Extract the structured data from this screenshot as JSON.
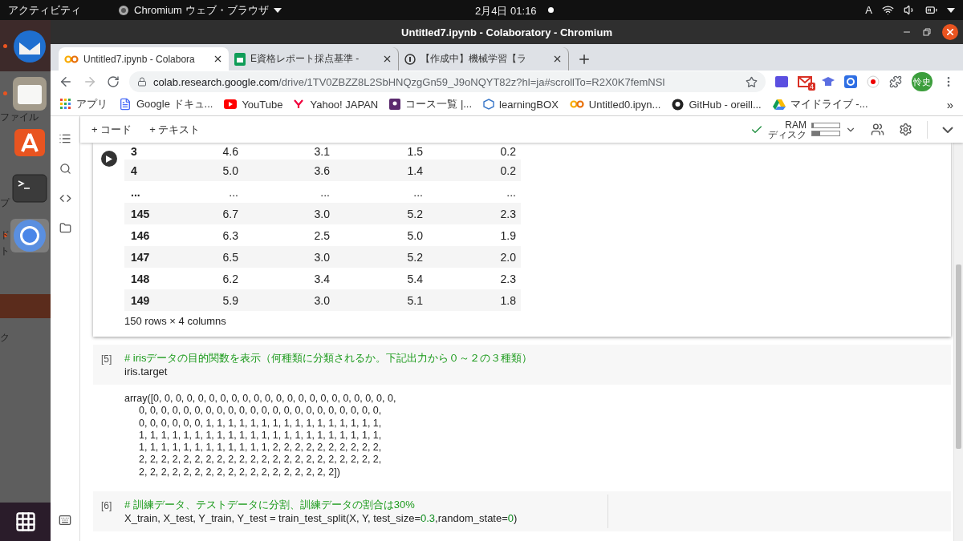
{
  "topbar": {
    "activities": "アクティビティ",
    "app_menu": "Chromium ウェブ・ブラウザ",
    "clock": "2月4日  01:16",
    "input_method": "A"
  },
  "dock": {
    "items": [
      {
        "kind": "mail",
        "running": true,
        "selected": false
      },
      {
        "kind": "files",
        "running": true,
        "selected": false
      },
      {
        "kind": "store",
        "running": false,
        "selected": false
      },
      {
        "kind": "terminal",
        "running": false,
        "selected": false
      },
      {
        "kind": "browser",
        "running": true,
        "selected": true
      }
    ],
    "label": "ファイル",
    "fragments": [
      "プ",
      "ド",
      "ト",
      "ク"
    ]
  },
  "window": {
    "title": "Untitled7.ipynb - Colaboratory - Chromium"
  },
  "tabs": [
    {
      "kind": "colab",
      "title": "Untitled7.ipynb - Colabora",
      "selected": true
    },
    {
      "kind": "sheets",
      "title": "E資格レポート採点基準 -",
      "selected": false
    },
    {
      "kind": "generic",
      "title": "【作成中】機械学習【ラ",
      "selected": false
    }
  ],
  "address": {
    "host": "colab.research.google.com",
    "path": "/drive/1TV0ZBZZ8L2SbHNQzgGn59_J9oNQYT82z?hl=ja#scrollTo=R2X0K7femNSl"
  },
  "extensions": {
    "mail_badge": "4",
    "profile": "怜史"
  },
  "bookmarks": [
    {
      "kind": "apps",
      "label": "アプリ"
    },
    {
      "kind": "docs",
      "label": "Google ドキュ..."
    },
    {
      "kind": "youtube",
      "label": "YouTube"
    },
    {
      "kind": "yahoo",
      "label": "Yahoo! JAPAN"
    },
    {
      "kind": "course",
      "label": "コース一覧 |..."
    },
    {
      "kind": "box",
      "label": "learningBOX"
    },
    {
      "kind": "colab",
      "label": "Untitled0.ipyn..."
    },
    {
      "kind": "github",
      "label": "GitHub - oreill..."
    },
    {
      "kind": "drive",
      "label": "マイドライブ -..."
    }
  ],
  "bookmarks_overflow": "»",
  "toolbar": {
    "add_code": "+ コード",
    "add_text": "+ テキスト",
    "ram": {
      "label": "RAM",
      "level": 0.05
    },
    "disk": {
      "label": "ディスク",
      "level": 0.3
    }
  },
  "table": {
    "rows": [
      {
        "index": "3",
        "values": [
          "4.6",
          "3.1",
          "1.5",
          "0.2"
        ]
      },
      {
        "index": "4",
        "values": [
          "5.0",
          "3.6",
          "1.4",
          "0.2"
        ]
      },
      {
        "index": "...",
        "values": [
          "...",
          "...",
          "...",
          "..."
        ]
      },
      {
        "index": "145",
        "values": [
          "6.7",
          "3.0",
          "5.2",
          "2.3"
        ]
      },
      {
        "index": "146",
        "values": [
          "6.3",
          "2.5",
          "5.0",
          "1.9"
        ]
      },
      {
        "index": "147",
        "values": [
          "6.5",
          "3.0",
          "5.2",
          "2.0"
        ]
      },
      {
        "index": "148",
        "values": [
          "6.2",
          "3.4",
          "5.4",
          "2.3"
        ]
      },
      {
        "index": "149",
        "values": [
          "5.9",
          "3.0",
          "5.1",
          "1.8"
        ]
      }
    ],
    "footer": "150 rows × 4 columns"
  },
  "cells": [
    {
      "prompt": "[5]",
      "lines": [
        [
          {
            "kind": "comment",
            "text": "# irisデータの目的関数を表示（何種類に分類されるか。下記出力から０～２の３種類）"
          }
        ],
        [
          {
            "kind": "plain",
            "text": "iris.target"
          }
        ]
      ],
      "output": [
        "array([0, 0, 0, 0, 0, 0, 0, 0, 0, 0, 0, 0, 0, 0, 0, 0, 0, 0, 0, 0, 0, 0,",
        "0, 0, 0, 0, 0, 0, 0, 0, 0, 0, 0, 0, 0, 0, 0, 0, 0, 0, 0, 0, 0, 0,",
        "0, 0, 0, 0, 0, 0, 1, 1, 1, 1, 1, 1, 1, 1, 1, 1, 1, 1, 1, 1, 1, 1,",
        "1, 1, 1, 1, 1, 1, 1, 1, 1, 1, 1, 1, 1, 1, 1, 1, 1, 1, 1, 1, 1, 1,",
        "1, 1, 1, 1, 1, 1, 1, 1, 1, 1, 1, 1, 2, 2, 2, 2, 2, 2, 2, 2, 2, 2,",
        "2, 2, 2, 2, 2, 2, 2, 2, 2, 2, 2, 2, 2, 2, 2, 2, 2, 2, 2, 2, 2, 2,",
        "2, 2, 2, 2, 2, 2, 2, 2, 2, 2, 2, 2, 2, 2, 2, 2, 2, 2])"
      ]
    },
    {
      "prompt": "[6]",
      "lines": [
        [
          {
            "kind": "comment",
            "text": "# 訓練データ、テストデータに分割、訓練データの割合は30%"
          }
        ],
        [
          {
            "kind": "plain",
            "text": "X_train, X_test, Y_train, Y_test = train_test_split(X, Y, test_size="
          },
          {
            "kind": "number",
            "text": "0.3"
          },
          {
            "kind": "plain",
            "text": ",random_state="
          },
          {
            "kind": "number",
            "text": "0"
          },
          {
            "kind": "plain",
            "text": ")"
          }
        ]
      ]
    }
  ]
}
